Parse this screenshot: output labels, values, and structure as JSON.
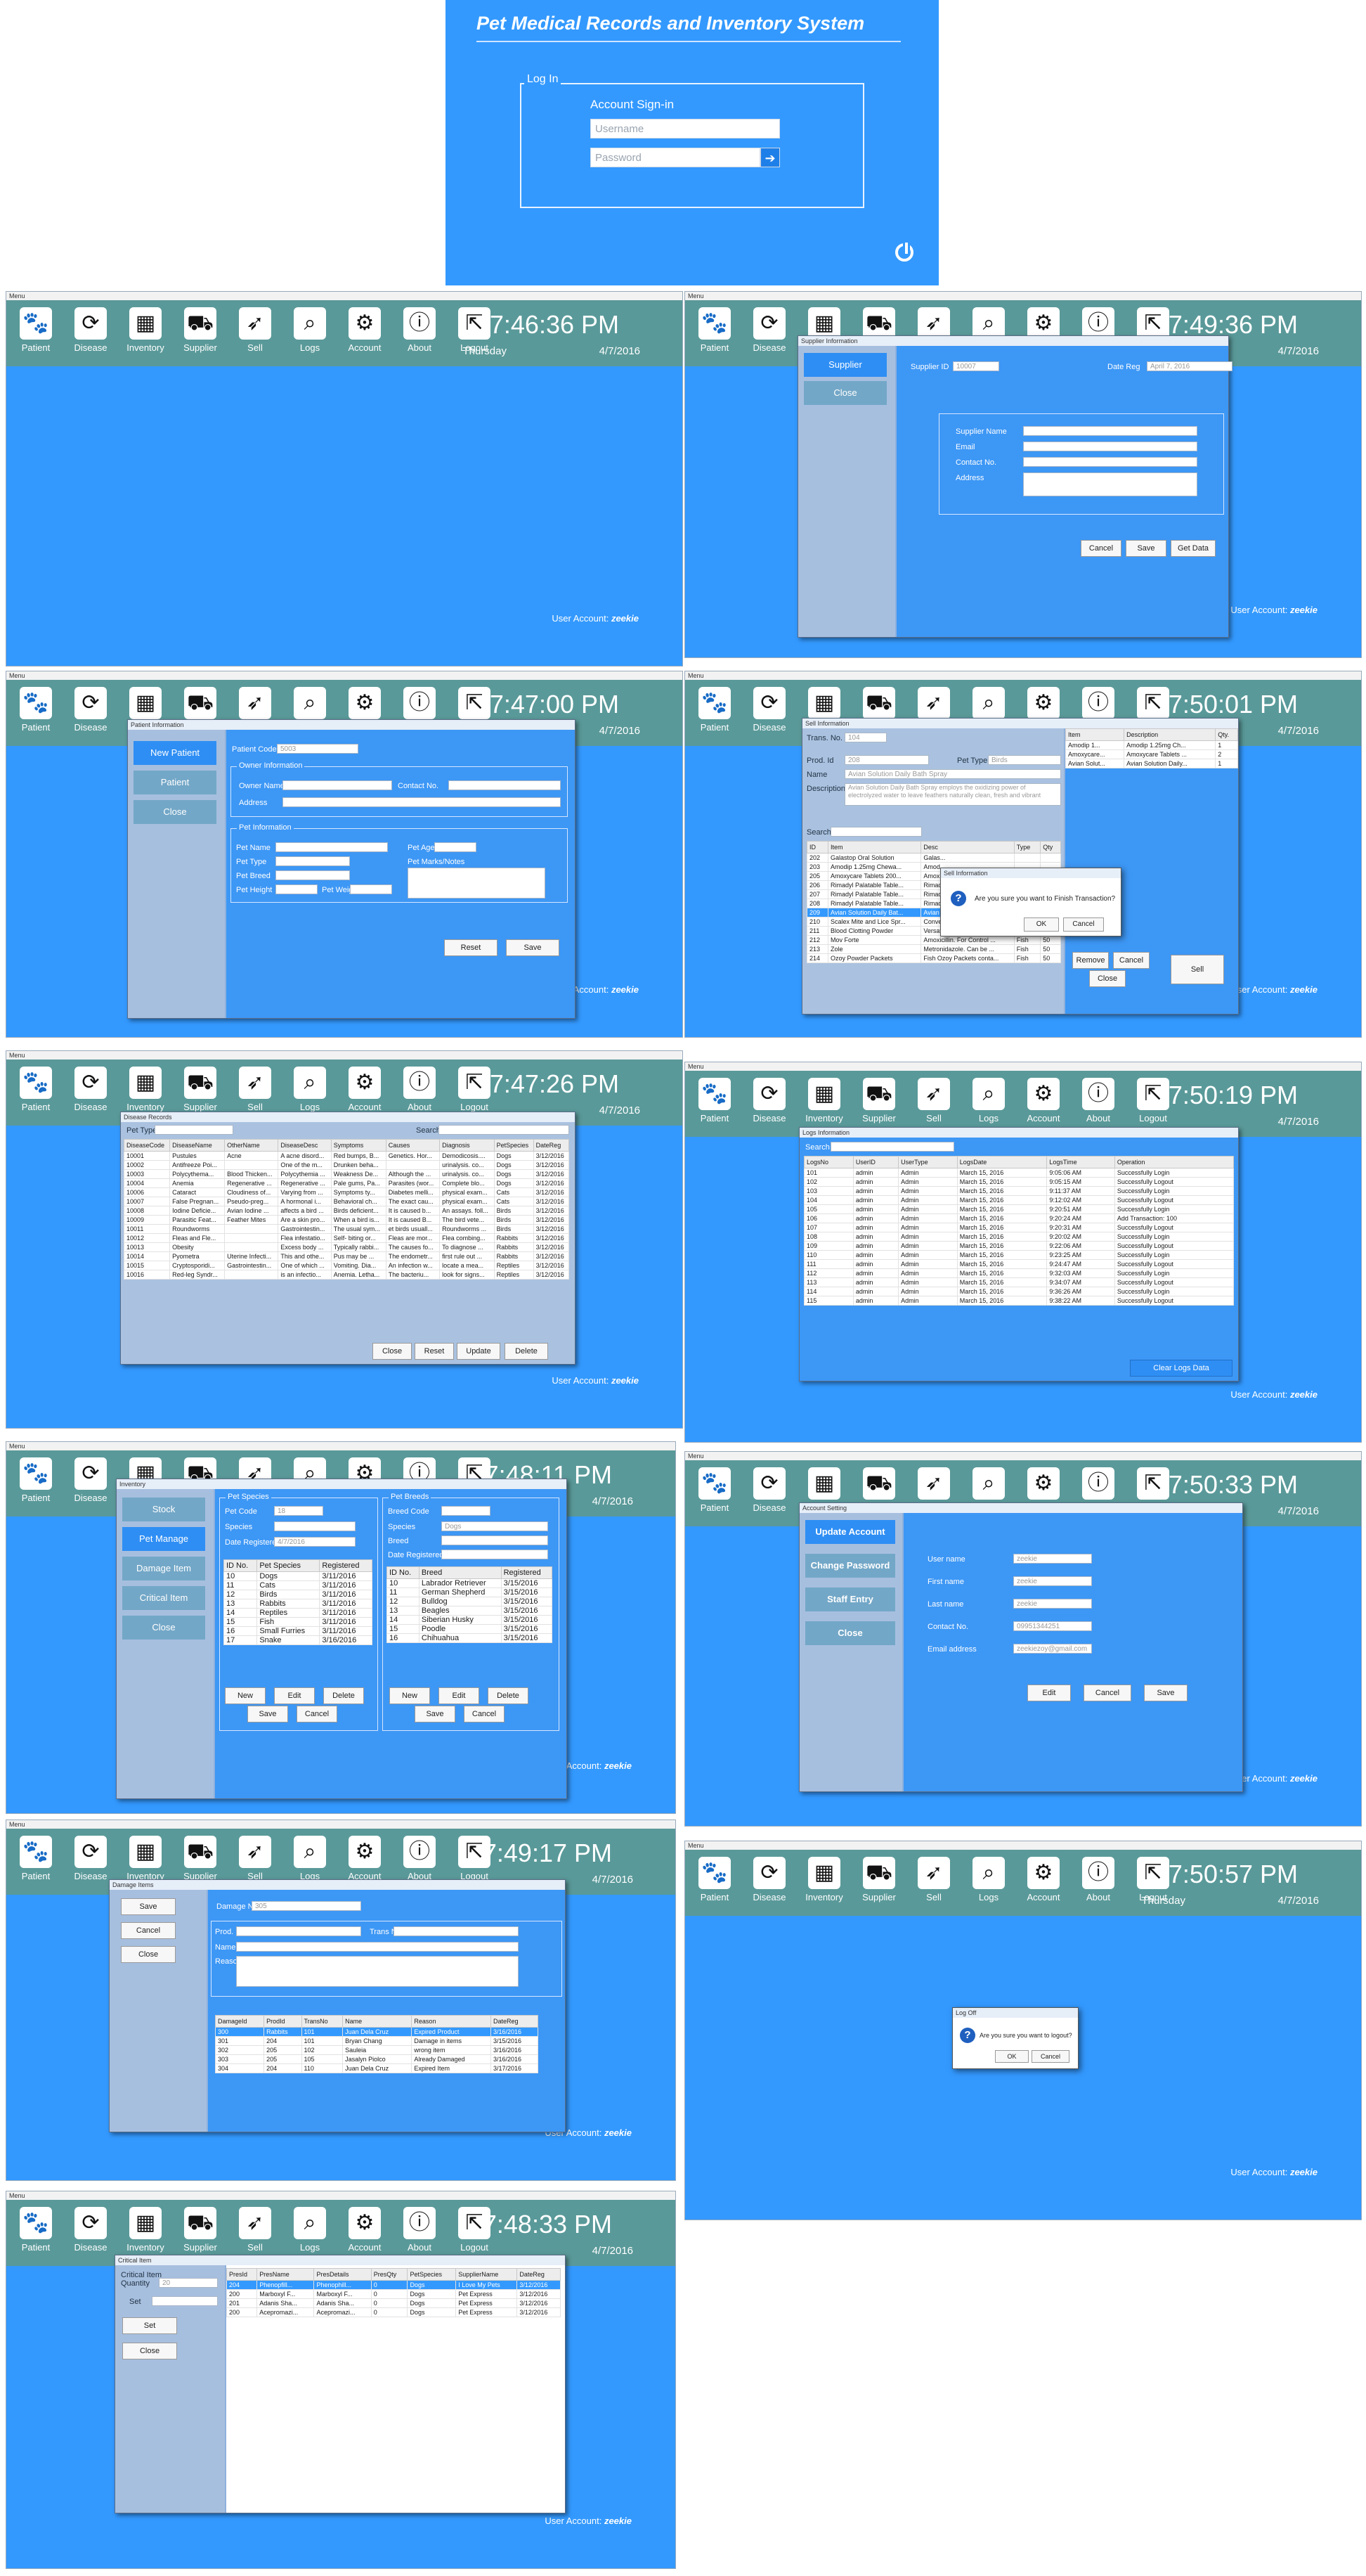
{
  "login": {
    "title": "Pet Medical Records and Inventory System",
    "legend": "Log In",
    "subtitle": "Account Sign-in",
    "username_placeholder": "Username",
    "password_placeholder": "Password"
  },
  "menu_label": "Menu",
  "toolbar_items": [
    {
      "label": "Patient",
      "icon": "paw-icon"
    },
    {
      "label": "Disease",
      "icon": "refresh-icon"
    },
    {
      "label": "Inventory",
      "icon": "box-icon"
    },
    {
      "label": "Supplier",
      "icon": "truck-icon"
    },
    {
      "label": "Sell",
      "icon": "rocket-icon"
    },
    {
      "label": "Logs",
      "icon": "search-icon"
    },
    {
      "label": "Account",
      "icon": "gear-icon"
    },
    {
      "label": "About",
      "icon": "info-icon"
    },
    {
      "label": "Logout",
      "icon": "logout-icon"
    }
  ],
  "user_account_label": "User Account:",
  "user_account_name": "zeekie",
  "date": "4/7/2016",
  "day": "Thursday",
  "screens": {
    "main": {
      "time": "7:46:36 PM"
    },
    "supplier": {
      "time": "7:49:36 PM",
      "title": "Supplier Information",
      "side": [
        "Supplier",
        "Close"
      ],
      "supplier_id_label": "Supplier ID",
      "supplier_id": "10007",
      "date_reg_label": "Date Reg",
      "date_reg": "April 7, 2016",
      "fields": [
        "Supplier Name",
        "Email",
        "Contact No.",
        "Address"
      ],
      "buttons": [
        "Cancel",
        "Save",
        "Get Data"
      ]
    },
    "patient": {
      "time": "7:47:00 PM",
      "title": "Patient Information",
      "side": [
        "New Patient",
        "Patient",
        "Close"
      ],
      "patient_code_label": "Patient Code",
      "patient_code": "5003",
      "owner_group": "Owner Information",
      "owner_name": "Owner Name",
      "contact_no": "Contact No.",
      "address": "Address",
      "pet_group": "Pet Information",
      "pet_labels": [
        "Pet Name",
        "Pet Type",
        "Pet Breed",
        "Pet Height"
      ],
      "pet_age": "Pet Age",
      "pet_remarks": "Pet Marks/Notes",
      "pet_weight": "Pet Weight",
      "buttons": [
        "Reset",
        "Save"
      ]
    },
    "sell": {
      "time": "7:50:01 PM",
      "title": "Sell Information",
      "trans_no_label": "Trans. No.",
      "trans_no": "104",
      "prod_id_label": "Prod. Id",
      "prod_id": "208",
      "pet_type_label": "Pet Type",
      "pet_type": "Birds",
      "name_label": "Name",
      "name": "Avian Solution Daily Bath Spray",
      "desc_label": "Description",
      "desc": "Avian Solution Daily Bath Spray employs the oxidizing power of electrolyzed water to leave feathers naturally clean, fresh and vibrant",
      "search_label": "Search",
      "cart_headers": [
        "Item",
        "Description",
        "Qty."
      ],
      "cart": [
        [
          "Amodip 1...",
          "Amodip 1.25mg Ch...",
          "1"
        ],
        [
          "Amoxycare...",
          "Amoxycare Tablets ...",
          "2"
        ],
        [
          "Avian Solut...",
          "Avian Solution Daily...",
          "1"
        ]
      ],
      "prod_headers": [
        "ID",
        "Item",
        "Desc",
        "Type",
        "Qty"
      ],
      "products": [
        [
          "202",
          "Galastop Oral Solution",
          "Galas...",
          "",
          ""
        ],
        [
          "203",
          "Amodip 1.25mg Chewa...",
          "Amod...",
          "",
          ""
        ],
        [
          "205",
          "Amoxycare Tablets 200...",
          "Amox...",
          "",
          ""
        ],
        [
          "206",
          "Rimadyl Palatable Table...",
          "Rimad...",
          "",
          ""
        ],
        [
          "207",
          "Rimadyl Palatable Table...",
          "Rimad...",
          "",
          ""
        ],
        [
          "208",
          "Rimadyl Palatable Table...",
          "Rimadyl Palatable Table...",
          "Cats",
          "50"
        ],
        [
          "209",
          "Avian Solution Daily Bat...",
          "Avian Solution Daily Bat...",
          "Birds",
          "50"
        ],
        [
          "210",
          "Scalex Mite and Lice Spr...",
          "Convenient liquid Mite a...",
          "Birds",
          "50"
        ],
        [
          "211",
          "Blood Clotting Powder",
          "Versatile clotting powde...",
          "Birds",
          "50"
        ],
        [
          "212",
          "Mov Forte",
          "Amoxicillin. For Control ...",
          "Fish",
          "50"
        ],
        [
          "213",
          "Zole",
          "Metronidazole. Can be ...",
          "Fish",
          "50"
        ],
        [
          "214",
          "Ozoy Powder Packets",
          "Fish Ozoy Packets conta...",
          "Fish",
          "50"
        ]
      ],
      "buttons": [
        "Remove",
        "Cancel",
        "Close",
        "Sell"
      ],
      "msg_title": "Sell Information",
      "msg_text": "Are you sure you want to Finish Transaction?",
      "msg_ok": "OK",
      "msg_cancel": "Cancel"
    },
    "disease": {
      "time": "7:47:26 PM",
      "title": "Disease Records",
      "pet_type_label": "Pet Type",
      "search_label": "Search",
      "headers": [
        "DiseaseCode",
        "DiseaseName",
        "OtherName",
        "DiseaseDesc",
        "Symptoms",
        "Causes",
        "Diagnosis",
        "PetSpecies",
        "DateReg"
      ],
      "rows": [
        [
          "10001",
          "Pustules",
          "Acne",
          "A acne disord...",
          "Red bumps, B...",
          "Genetics. Hor...",
          "Demodicosis....",
          "Dogs",
          "3/12/2016"
        ],
        [
          "10002",
          "Antifreeze Poi...",
          "",
          "One of the m...",
          "Drunken beha...",
          "",
          "urinalysis. co...",
          "Dogs",
          "3/12/2016"
        ],
        [
          "10003",
          "Polycythema...",
          "Blood Thicken...",
          "Polycythemia ...",
          "Weakness De...",
          "Although the ...",
          "urinalysis. co...",
          "Dogs",
          "3/12/2016"
        ],
        [
          "10004",
          "Anemia",
          "Regenerative ...",
          "Regenerative ...",
          "Pale gums, Pa...",
          "Parasites (wor...",
          "Complete blo...",
          "Dogs",
          "3/12/2016"
        ],
        [
          "10006",
          "Cataract",
          "Cloudiness of...",
          "Varying from ...",
          "Symptoms ty...",
          "Diabetes melli...",
          "physical exam...",
          "Cats",
          "3/12/2016"
        ],
        [
          "10007",
          "False Pregnan...",
          "Pseudo-preg...",
          "A hormonal i...",
          "Behavioral ch...",
          "The exact cau...",
          "physical exam...",
          "Cats",
          "3/12/2016"
        ],
        [
          "10008",
          "Iodine Deficie...",
          "Avian Iodine ...",
          "affects a bird ...",
          "Birds deficient...",
          "It is caused b...",
          "An assays. foll...",
          "Birds",
          "3/12/2016"
        ],
        [
          "10009",
          "Parasitic Feat...",
          "Feather Mites",
          "Are a skin pro...",
          "When a bird is...",
          "It is caused B...",
          "The bird vete...",
          "Birds",
          "3/12/2016"
        ],
        [
          "10011",
          "Roundworms",
          "",
          "Gastrointestin...",
          "The usual sym...",
          "et birds usuall...",
          "Roundworms ...",
          "Birds",
          "3/12/2016"
        ],
        [
          "10012",
          "Fleas and Fle...",
          "",
          "Flea infestatio...",
          "Self- biting or...",
          "Fleas are mor...",
          "Flea combing...",
          "Rabbits",
          "3/12/2016"
        ],
        [
          "10013",
          "Obesity",
          "",
          "Excess body ...",
          "Typically rabbi...",
          "The causes fo...",
          "To diagnose ...",
          "Rabbits",
          "3/12/2016"
        ],
        [
          "10014",
          "Pyometra",
          "Uterine Infecti...",
          "This and othe...",
          "Pus may be ...",
          "The endometr...",
          "first rule out ...",
          "Rabbits",
          "3/12/2016"
        ],
        [
          "10015",
          "Cryptosporidi...",
          "Gastrointestin...",
          "One of which ...",
          "Vomiting. Dia...",
          "An infection w...",
          "locate a mea...",
          "Reptiles",
          "3/12/2016"
        ],
        [
          "10016",
          "Red-leg Syndr...",
          "",
          "is an infectio...",
          "Anemia. Letha...",
          "The bacteriu...",
          "look for signs...",
          "Reptiles",
          "3/12/2016"
        ]
      ],
      "buttons": [
        "Close",
        "Reset",
        "Update",
        "Delete"
      ]
    },
    "logs": {
      "time": "7:50:19 PM",
      "title": "Logs Information",
      "search_label": "Search",
      "headers": [
        "LogsNo",
        "UserID",
        "UserType",
        "LogsDate",
        "LogsTime",
        "Operation"
      ],
      "rows": [
        [
          "101",
          "admin",
          "Admin",
          "March 15, 2016",
          "9:05:06 AM",
          "Successfully Login"
        ],
        [
          "102",
          "admin",
          "Admin",
          "March 15, 2016",
          "9:05:15 AM",
          "Successfully Logout"
        ],
        [
          "103",
          "admin",
          "Admin",
          "March 15, 2016",
          "9:11:37 AM",
          "Successfully Login"
        ],
        [
          "104",
          "admin",
          "Admin",
          "March 15, 2016",
          "9:12:02 AM",
          "Successfully Logout"
        ],
        [
          "105",
          "admin",
          "Admin",
          "March 15, 2016",
          "9:20:51 AM",
          "Successfully Login"
        ],
        [
          "106",
          "admin",
          "Admin",
          "March 15, 2016",
          "9:20:24 AM",
          "Add Transaction: 100"
        ],
        [
          "107",
          "admin",
          "Admin",
          "March 15, 2016",
          "9:20:31 AM",
          "Successfully Logout"
        ],
        [
          "108",
          "admin",
          "Admin",
          "March 15, 2016",
          "9:20:02 AM",
          "Successfully Login"
        ],
        [
          "109",
          "admin",
          "Admin",
          "March 15, 2016",
          "9:22:06 AM",
          "Successfully Logout"
        ],
        [
          "110",
          "admin",
          "Admin",
          "March 15, 2016",
          "9:23:25 AM",
          "Successfully Login"
        ],
        [
          "111",
          "admin",
          "Admin",
          "March 15, 2016",
          "9:24:47 AM",
          "Successfully Logout"
        ],
        [
          "112",
          "admin",
          "Admin",
          "March 15, 2016",
          "9:32:03 AM",
          "Successfully Login"
        ],
        [
          "113",
          "admin",
          "Admin",
          "March 15, 2016",
          "9:34:07 AM",
          "Successfully Logout"
        ],
        [
          "114",
          "admin",
          "Admin",
          "March 15, 2016",
          "9:36:26 AM",
          "Successfully Login"
        ],
        [
          "115",
          "admin",
          "Admin",
          "March 15, 2016",
          "9:38:22 AM",
          "Successfully Logout"
        ]
      ],
      "clear_button": "Clear Logs Data"
    },
    "inventory": {
      "time": "7:48:11 PM",
      "title": "Inventory",
      "side": [
        "Stock",
        "Pet Manage",
        "Damage Item",
        "Critical Item",
        "Close"
      ],
      "species_group": "Pet Species",
      "pet_code_label": "Pet Code",
      "pet_code": "18",
      "species_label": "Species",
      "date_reg_label": "Date Registered",
      "date_reg": "4/7/2016",
      "species_headers": [
        "ID No.",
        "Pet Species",
        "Registered"
      ],
      "species_rows": [
        [
          "10",
          "Dogs",
          "3/11/2016"
        ],
        [
          "11",
          "Cats",
          "3/11/2016"
        ],
        [
          "12",
          "Birds",
          "3/11/2016"
        ],
        [
          "13",
          "Rabbits",
          "3/11/2016"
        ],
        [
          "14",
          "Reptiles",
          "3/11/2016"
        ],
        [
          "15",
          "Fish",
          "3/11/2016"
        ],
        [
          "16",
          "Small Furries",
          "3/11/2016"
        ],
        [
          "17",
          "Snake",
          "3/16/2016"
        ]
      ],
      "breeds_group": "Pet Breeds",
      "breed_code_label": "Breed Code",
      "species2_label": "Species",
      "species2_value": "Dogs",
      "breed_label": "Breed",
      "date_reg2_label": "Date Registered",
      "breed_headers": [
        "ID No.",
        "Breed",
        "Registered"
      ],
      "breed_rows": [
        [
          "10",
          "Labrador Retriever",
          "3/15/2016"
        ],
        [
          "11",
          "German Shepherd",
          "3/15/2016"
        ],
        [
          "12",
          "Bulldog",
          "3/15/2016"
        ],
        [
          "13",
          "Beagles",
          "3/15/2016"
        ],
        [
          "14",
          "Siberian Husky",
          "3/15/2016"
        ],
        [
          "15",
          "Poodle",
          "3/15/2016"
        ],
        [
          "16",
          "Chihuahua",
          "3/15/2016"
        ]
      ],
      "row_buttons": [
        "New",
        "Edit",
        "Delete"
      ],
      "save_cancel": [
        "Save",
        "Cancel"
      ]
    },
    "account": {
      "time": "7:50:33 PM",
      "title": "Account Setting",
      "side": [
        "Update Account",
        "Change Password",
        "Staff Entry",
        "Close"
      ],
      "labels": [
        "User name",
        "First name",
        "Last name",
        "Contact No.",
        "Email address"
      ],
      "values": [
        "zeekie",
        "zeekie",
        "zeekie",
        "09951344251",
        "zeekiezoy@gmail.com"
      ],
      "buttons": [
        "Edit",
        "Cancel",
        "Save"
      ]
    },
    "damage": {
      "time": "7:49:17 PM",
      "title": "Damage Items",
      "side": [
        "Save",
        "Cancel",
        "Close"
      ],
      "damage_no_label": "Damage No.",
      "damage_no": "305",
      "prod_id_label": "Prod. Id",
      "trans_no_label": "Trans No.",
      "name_label": "Name",
      "reason_label": "Reason",
      "headers": [
        "DamageId",
        "ProdId",
        "TransNo",
        "Name",
        "Reason",
        "DateReg"
      ],
      "rows": [
        [
          "300",
          "Rabbits",
          "101",
          "Juan Dela Cruz",
          "Expired Product",
          "3/16/2016"
        ],
        [
          "301",
          "204",
          "101",
          "Bryan Chang",
          "Damage in items",
          "3/15/2016"
        ],
        [
          "302",
          "205",
          "102",
          "Sauleia",
          "wrong item",
          "3/16/2016"
        ],
        [
          "303",
          "205",
          "105",
          "Jasalyn Piolco",
          "Already Damaged",
          "3/16/2016"
        ],
        [
          "304",
          "204",
          "110",
          "Juan Dela Cruz",
          "Expired Item",
          "3/17/2016"
        ]
      ]
    },
    "logout": {
      "time": "7:50:57 PM",
      "msg_title": "Log Off",
      "msg_text": "Are you sure you want to logout?",
      "ok": "OK",
      "cancel": "Cancel"
    },
    "critical": {
      "time": "7:48:33 PM",
      "title": "Critical Item",
      "critical_label": "Critical Item",
      "quantity_label": "Quantity",
      "quantity": "20",
      "set_label": "Set",
      "buttons": [
        "Set",
        "Close"
      ],
      "headers": [
        "PresId",
        "PresName",
        "PresDetails",
        "PresQty",
        "PetSpecies",
        "SupplierName",
        "DateReg"
      ],
      "rows": [
        [
          "204",
          "Phenopfill...",
          "Phenophill...",
          "0",
          "Dogs",
          "I Love My Pets",
          "3/12/2016"
        ],
        [
          "200",
          "Marboxyl F...",
          "Marboxyl F...",
          "0",
          "Dogs",
          "Pet Express",
          "3/12/2016"
        ],
        [
          "201",
          "Adanis Sha...",
          "Adanis Sha...",
          "0",
          "Dogs",
          "Pet Express",
          "3/12/2016"
        ],
        [
          "200",
          "Acepromazi...",
          "Acepromazi...",
          "0",
          "Dogs",
          "Pet Express",
          "3/12/2016"
        ]
      ]
    }
  }
}
